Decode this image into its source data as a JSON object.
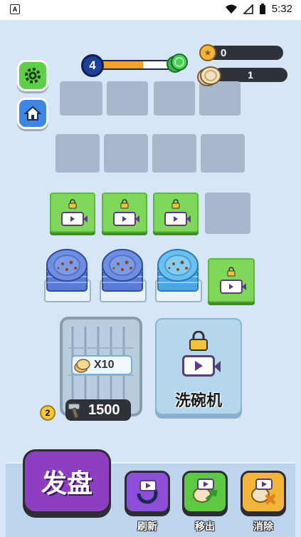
{
  "status_bar": {
    "app_icon": "A",
    "time": "5:32",
    "icons": [
      "wifi-icon",
      "signal-icon",
      "battery-icon"
    ]
  },
  "level": {
    "current": "4",
    "progress": 0.55
  },
  "currency": {
    "coins": "0",
    "plates": "1"
  },
  "rack": {
    "multiplier": "X10",
    "price": "1500",
    "level": "2"
  },
  "dishwasher": {
    "label": "洗碗机"
  },
  "bottom": {
    "deal_label": "发盘",
    "actions": [
      {
        "label": "刷新",
        "icon": "refresh-icon"
      },
      {
        "label": "移出",
        "icon": "move-out-icon"
      },
      {
        "label": "消除",
        "icon": "remove-icon"
      }
    ]
  },
  "colors": {
    "accent_green": "#7fd85a",
    "deal_purple": "#8e3fc1",
    "bar_fill": "#f2a32a"
  }
}
